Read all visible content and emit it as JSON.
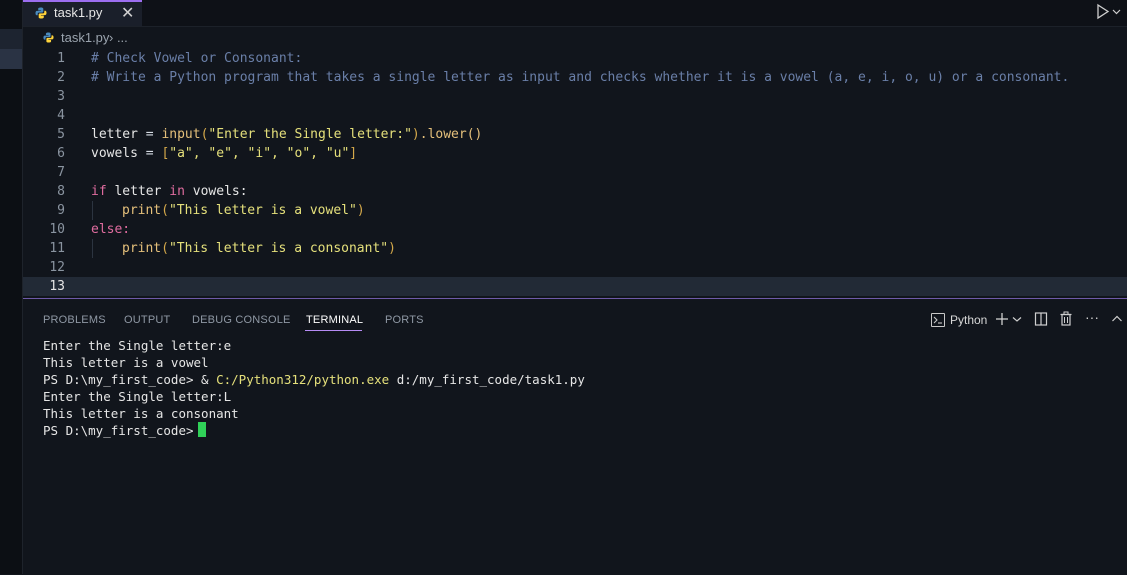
{
  "tab": {
    "filename": "task1.py",
    "close": "✕"
  },
  "breadcrumb": {
    "file": "task1.py",
    "separator": "› ..."
  },
  "editor": {
    "lines": [
      {
        "num": "1",
        "text": "# Check Vowel or Consonant:"
      },
      {
        "num": "2",
        "text": "# Write a Python program that takes a single letter as input and checks whether it is a vowel (a, e, i, o, u) or a consonant."
      },
      {
        "num": "3",
        "text": ""
      },
      {
        "num": "4",
        "text": ""
      },
      {
        "num": "5",
        "text": "letter = input(\"Enter the Single letter:\").lower()"
      },
      {
        "num": "6",
        "text": "vowels = [\"a\", \"e\", \"i\", \"o\", \"u\"]"
      },
      {
        "num": "7",
        "text": ""
      },
      {
        "num": "8",
        "text": "if letter in vowels:"
      },
      {
        "num": "9",
        "text": "    print(\"This letter is a vowel\")"
      },
      {
        "num": "10",
        "text": "else:"
      },
      {
        "num": "11",
        "text": "    print(\"This letter is a consonant\")"
      },
      {
        "num": "12",
        "text": ""
      },
      {
        "num": "13",
        "text": ""
      }
    ],
    "tokens": {
      "l1": "# Check Vowel or Consonant:",
      "l2": "# Write a Python program that takes a single letter as input and checks whether it is a vowel (a, e, i, o, u) or a consonant.",
      "l5_var": "letter",
      "l5_eq": " = ",
      "l5_fn": "input",
      "l5_open": "(",
      "l5_str": "\"Enter the Single letter:\"",
      "l5_close": ")",
      "l5_method": ".lower()",
      "l6_var": "vowels",
      "l6_eq": " = ",
      "l6_open": "[",
      "l6_items": "\"a\", \"e\", \"i\", \"o\", \"u\"",
      "l6_close": "]",
      "l8_if": "if",
      "l8_var": " letter ",
      "l8_in": "in",
      "l8_rest": " vowels:",
      "l9_fn": "print",
      "l9_open": "(",
      "l9_str": "\"This letter is a vowel\"",
      "l9_close": ")",
      "l10_else": "else:",
      "l11_fn": "print",
      "l11_open": "(",
      "l11_str": "\"This letter is a consonant\"",
      "l11_close": ")"
    }
  },
  "panel": {
    "tabs": [
      "PROBLEMS",
      "OUTPUT",
      "DEBUG CONSOLE",
      "TERMINAL",
      "PORTS"
    ],
    "active_tab": "TERMINAL",
    "terminal_profile": "Python",
    "more": "···"
  },
  "terminal": {
    "l1": "Enter the Single letter:e",
    "l2": "This letter is a vowel",
    "l3_prompt": "PS D:\\my_first_code> & ",
    "l3_path": "C:/Python312/python.exe",
    "l3_arg": " d:/my_first_code/task1.py",
    "l4": "Enter the Single letter:L",
    "l5": "This letter is a consonant",
    "l6_prompt": "PS D:\\my_first_code>"
  },
  "colors": {
    "accent": "#9c6ef0",
    "cursor": "#30d158",
    "string": "#e5e07b",
    "keyword": "#e06c9f",
    "comment": "#6a7fa8"
  }
}
